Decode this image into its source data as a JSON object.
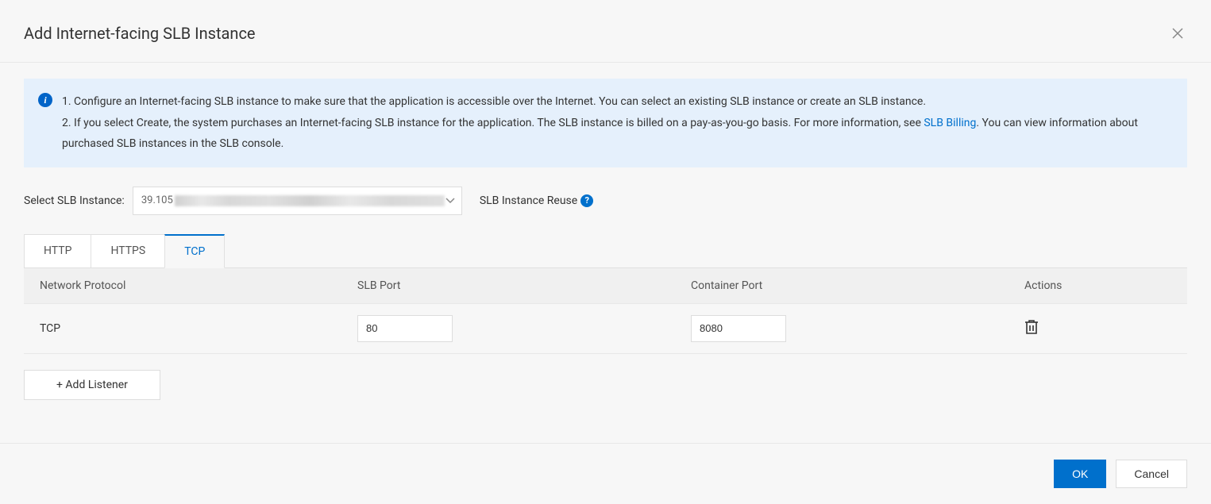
{
  "dialog": {
    "title": "Add Internet-facing SLB Instance"
  },
  "info": {
    "line1": "1. Configure an Internet-facing SLB instance to make sure that the application is accessible over the Internet. You can select an existing SLB instance or create an SLB instance.",
    "line2a": "2. If you select Create, the system purchases an Internet-facing SLB instance for the application. The SLB instance is billed on a pay-as-you-go basis. For more information, see ",
    "link": "SLB Billing",
    "line2b": ". You can view information about purchased SLB instances in the SLB console."
  },
  "select": {
    "label": "Select SLB Instance:",
    "value_prefix": "39.105",
    "reuse_label": "SLB Instance Reuse"
  },
  "tabs": {
    "http": "HTTP",
    "https": "HTTPS",
    "tcp": "TCP"
  },
  "table": {
    "headers": {
      "protocol": "Network Protocol",
      "slb_port": "SLB Port",
      "container_port": "Container Port",
      "actions": "Actions"
    },
    "row": {
      "protocol": "TCP",
      "slb_port": "80",
      "container_port": "8080"
    }
  },
  "buttons": {
    "add_listener": "+ Add Listener",
    "ok": "OK",
    "cancel": "Cancel"
  }
}
